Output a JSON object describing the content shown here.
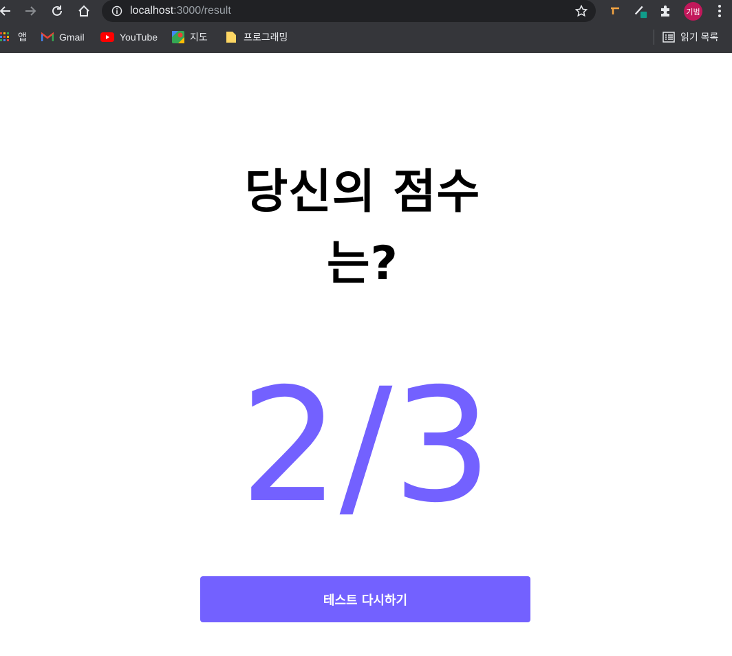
{
  "browser": {
    "url_host": "localhost",
    "url_path": ":3000/result",
    "profile_initials": "기범",
    "bookmarks": [
      {
        "label": "앱",
        "icon": "apps-grid-icon"
      },
      {
        "label": "Gmail",
        "icon": "gmail-icon"
      },
      {
        "label": "YouTube",
        "icon": "youtube-icon"
      },
      {
        "label": "지도",
        "icon": "maps-icon"
      },
      {
        "label": "프로그래밍",
        "icon": "folder-icon"
      }
    ],
    "reading_list_label": "읽기 목록",
    "chrome_color": "#35363a"
  },
  "page": {
    "heading_line1": "당신의 점수",
    "heading_line2": "는?",
    "score": "2/3",
    "retry_button_label": "테스트 다시하기",
    "accent_color": "#7361ff"
  }
}
